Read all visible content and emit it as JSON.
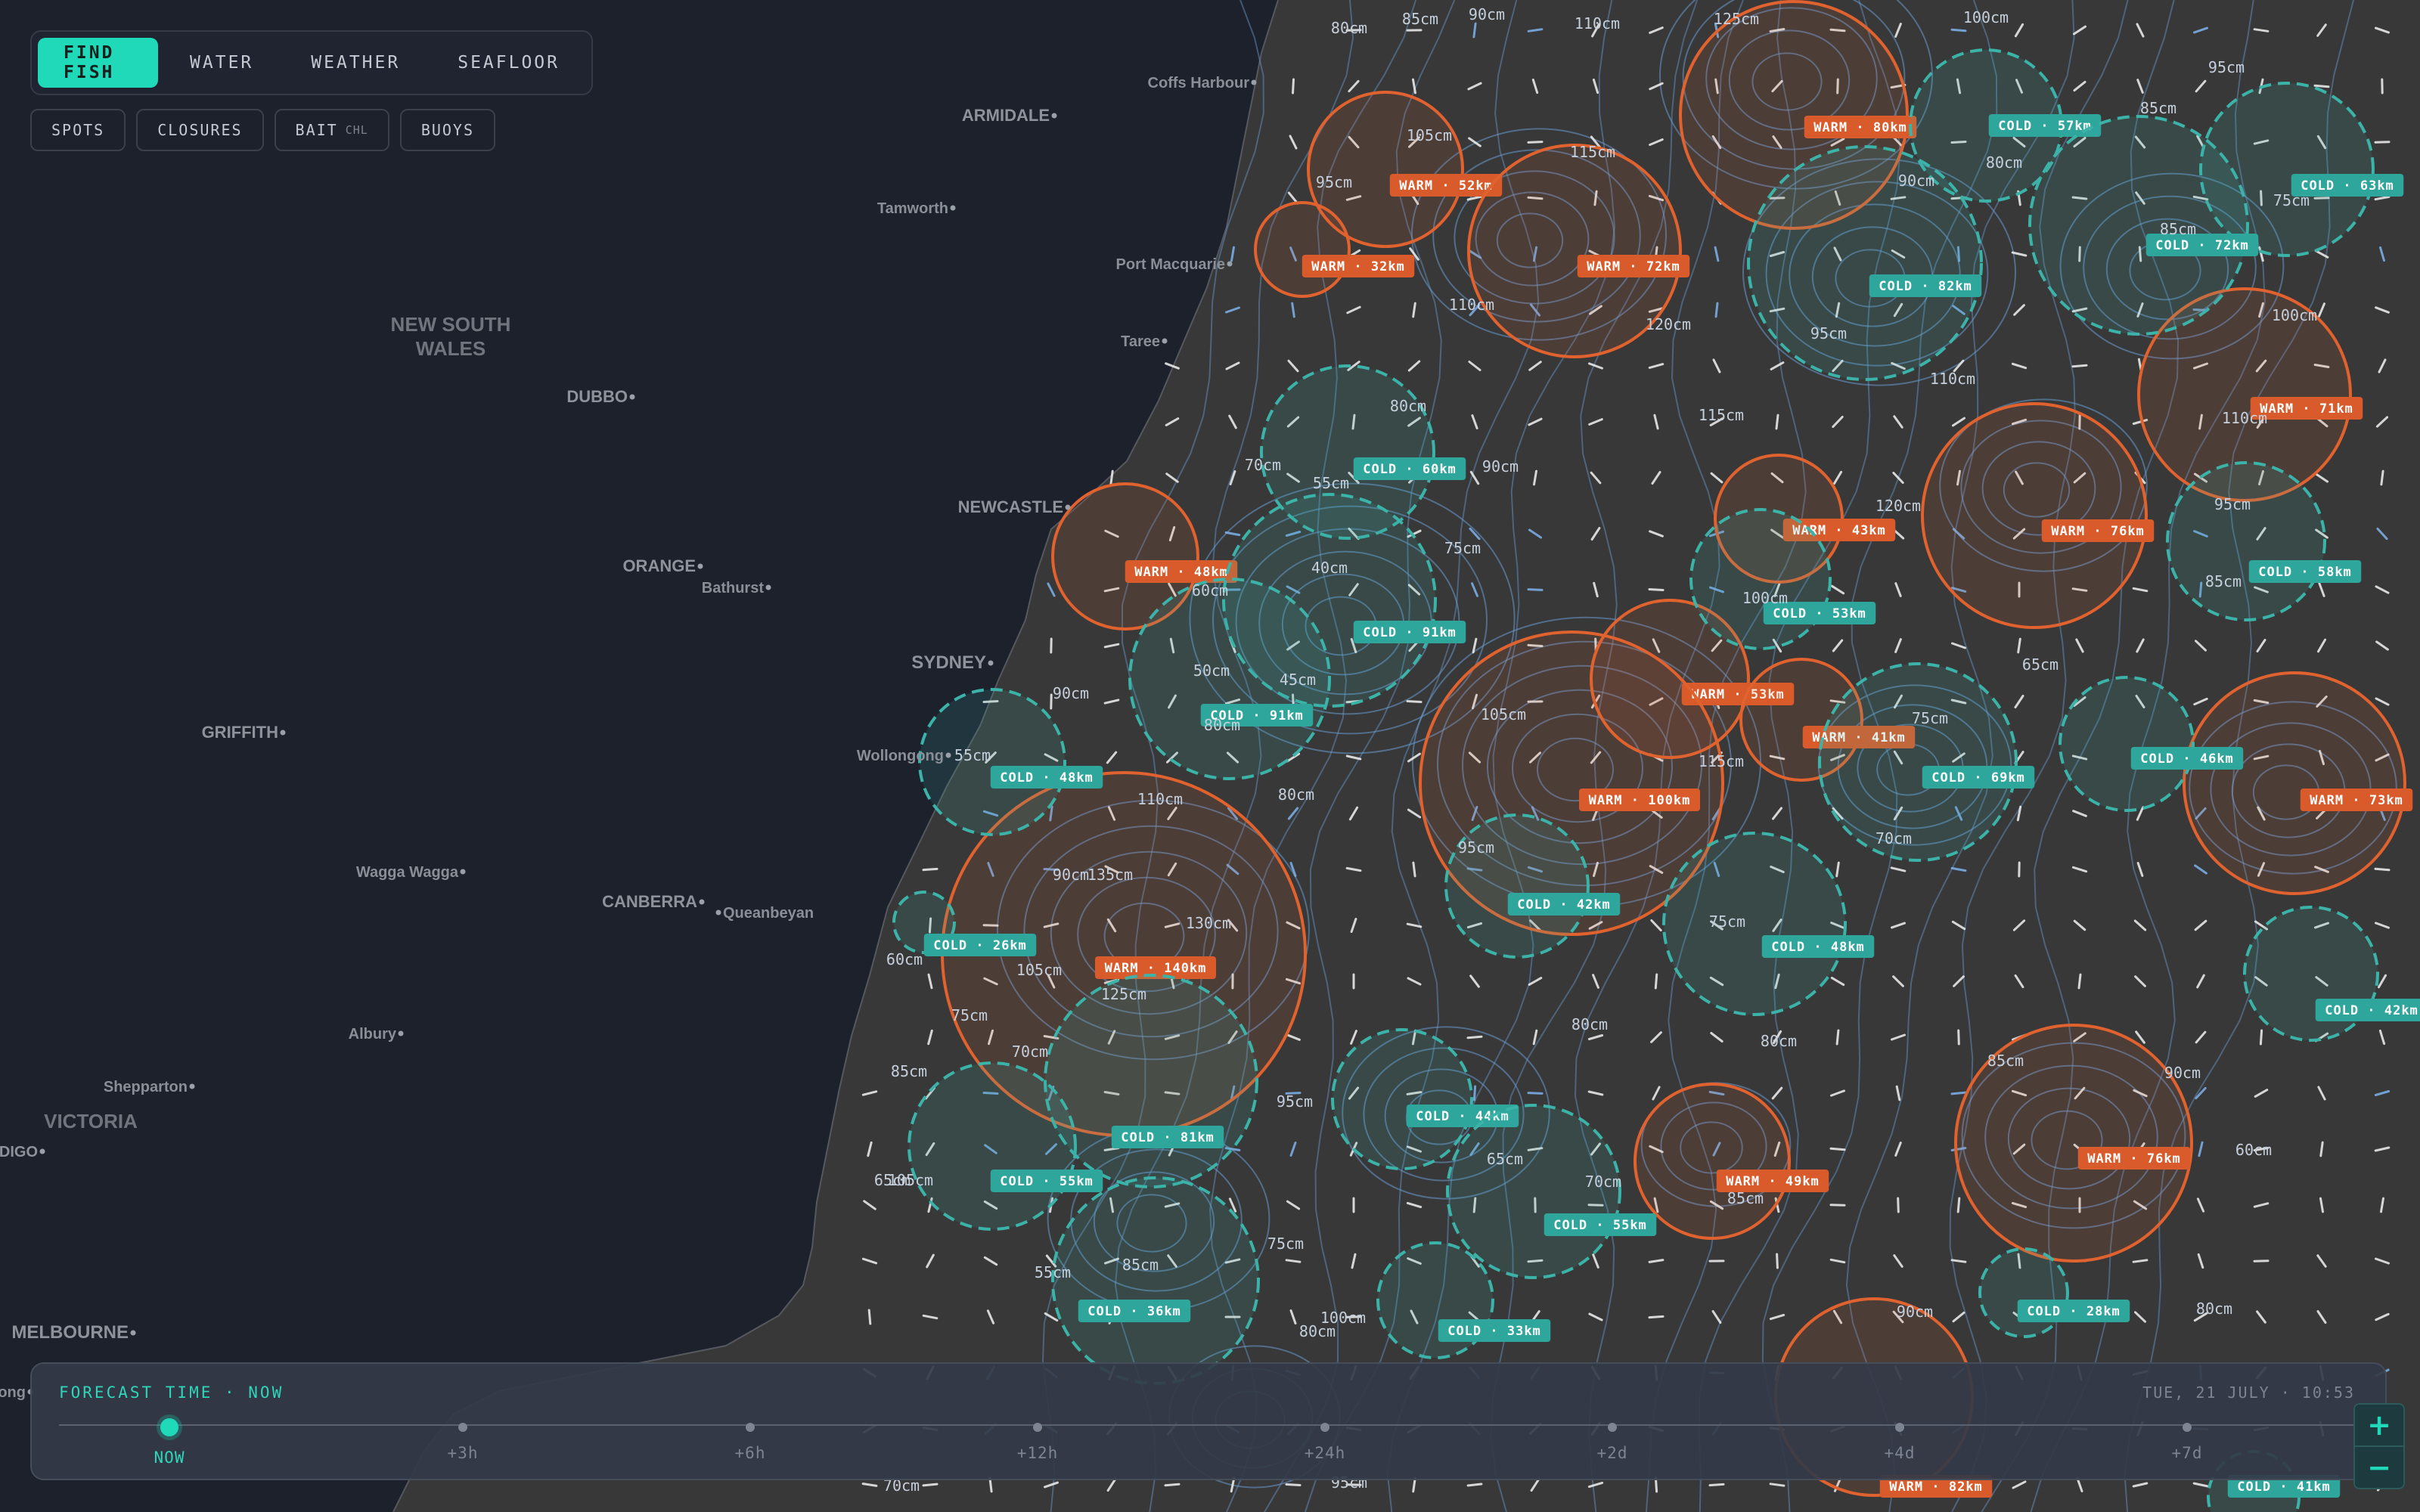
{
  "toolbar": {
    "tabs": [
      {
        "label": "FIND FISH",
        "active": true
      },
      {
        "label": "WATER",
        "active": false
      },
      {
        "label": "WEATHER",
        "active": false
      },
      {
        "label": "SEAFLOOR",
        "active": false
      }
    ],
    "chips": [
      {
        "label": "SPOTS",
        "sub": ""
      },
      {
        "label": "CLOSURES",
        "sub": ""
      },
      {
        "label": "BAIT",
        "sub": "CHL"
      },
      {
        "label": "BUOYS",
        "sub": ""
      }
    ]
  },
  "map": {
    "colors": {
      "land": "#1c212c",
      "ocean": "#383838",
      "warm": "#e0622f",
      "cold": "#3cb3a8",
      "contour": "#6a9bd0",
      "accent": "#1fd9b8"
    },
    "regions": [
      {
        "lines": [
          "NEW SOUTH",
          "WALES"
        ]
      },
      {
        "lines": [
          "VICTORIA"
        ]
      }
    ],
    "cities": [
      "Coffs Harbour",
      "ARMIDALE",
      "Tamworth",
      "Port Macquarie",
      "Taree",
      "DUBBO",
      "NEWCASTLE",
      "ORANGE",
      "Bathurst",
      "SYDNEY",
      "Wollongong",
      "GRIFFITH",
      "Wagga Wagga",
      "CANBERRA",
      "Queanbeyan",
      "Albury",
      "Shepparton",
      "BENDIGO",
      "MELBOURNE",
      "Geelong"
    ],
    "eddies": [
      {
        "type": "WARM",
        "label": "WARM · 80km"
      },
      {
        "type": "WARM",
        "label": "WARM · 52km"
      },
      {
        "type": "WARM",
        "label": "WARM · 32km"
      },
      {
        "type": "WARM",
        "label": "WARM · 72km"
      },
      {
        "type": "WARM",
        "label": "WARM · 71km"
      },
      {
        "type": "WARM",
        "label": "WARM · 43km"
      },
      {
        "type": "WARM",
        "label": "WARM · 76km"
      },
      {
        "type": "WARM",
        "label": "WARM · 48km"
      },
      {
        "type": "WARM",
        "label": "WARM · 53km"
      },
      {
        "type": "WARM",
        "label": "WARM · 41km"
      },
      {
        "type": "WARM",
        "label": "WARM · 100km"
      },
      {
        "type": "WARM",
        "label": "WARM · 73km"
      },
      {
        "type": "WARM",
        "label": "WARM · 140km"
      },
      {
        "type": "WARM",
        "label": "WARM · 49km"
      },
      {
        "type": "WARM",
        "label": "WARM · 76km"
      },
      {
        "type": "WARM",
        "label": "WARM · 82km"
      },
      {
        "type": "COLD",
        "label": "COLD · 57km"
      },
      {
        "type": "COLD",
        "label": "COLD · 63km"
      },
      {
        "type": "COLD",
        "label": "COLD · 72km"
      },
      {
        "type": "COLD",
        "label": "COLD · 82km"
      },
      {
        "type": "COLD",
        "label": "COLD · 60km"
      },
      {
        "type": "COLD",
        "label": "COLD · 91km"
      },
      {
        "type": "COLD",
        "label": "COLD · 91km"
      },
      {
        "type": "COLD",
        "label": "COLD · 58km"
      },
      {
        "type": "COLD",
        "label": "COLD · 53km"
      },
      {
        "type": "COLD",
        "label": "COLD · 46km"
      },
      {
        "type": "COLD",
        "label": "COLD · 69km"
      },
      {
        "type": "COLD",
        "label": "COLD · 48km"
      },
      {
        "type": "COLD",
        "label": "COLD · 42km"
      },
      {
        "type": "COLD",
        "label": "COLD · 48km"
      },
      {
        "type": "COLD",
        "label": "COLD · 26km"
      },
      {
        "type": "COLD",
        "label": "COLD · 42km"
      },
      {
        "type": "COLD",
        "label": "COLD · 44km"
      },
      {
        "type": "COLD",
        "label": "COLD · 81km"
      },
      {
        "type": "COLD",
        "label": "COLD · 55km"
      },
      {
        "type": "COLD",
        "label": "COLD · 55km"
      },
      {
        "type": "COLD",
        "label": "COLD · 28km"
      },
      {
        "type": "COLD",
        "label": "COLD · 36km"
      },
      {
        "type": "COLD",
        "label": "COLD · 33km"
      },
      {
        "type": "COLD",
        "label": "COLD · 41km"
      }
    ],
    "contour_labels": [
      "80cm",
      "85cm",
      "90cm",
      "110cm",
      "125cm",
      "100cm",
      "95cm",
      "85cm",
      "105cm",
      "115cm",
      "95cm",
      "80cm",
      "90cm",
      "75cm",
      "110cm",
      "120cm",
      "95cm",
      "85cm",
      "100cm",
      "110cm",
      "80cm",
      "115cm",
      "110cm",
      "70cm",
      "55cm",
      "90cm",
      "120cm",
      "95cm",
      "75cm",
      "60cm",
      "40cm",
      "100cm",
      "85cm",
      "50cm",
      "45cm",
      "90cm",
      "80cm",
      "65cm",
      "105cm",
      "115cm",
      "55cm",
      "110cm",
      "75cm",
      "80cm",
      "70cm",
      "90cm",
      "135cm",
      "95cm",
      "130cm",
      "60cm",
      "105cm",
      "125cm",
      "75cm",
      "75cm",
      "85cm",
      "95cm",
      "70cm",
      "80cm",
      "65cm",
      "80cm",
      "85cm",
      "90cm",
      "55cm",
      "85cm",
      "65cm",
      "70cm",
      "85cm",
      "75cm",
      "90cm",
      "60cm",
      "105cm",
      "100cm",
      "80cm",
      "80cm",
      "70cm",
      "95cm"
    ]
  },
  "timeline": {
    "title": "FORECAST TIME · NOW",
    "date": "TUE, 21 JULY · 10:53",
    "ticks": [
      "NOW",
      "+3h",
      "+6h",
      "+12h",
      "+24h",
      "+2d",
      "+4d",
      "+7d"
    ],
    "current_index": 0
  },
  "zoom": {
    "in_label": "+",
    "out_label": "−"
  }
}
